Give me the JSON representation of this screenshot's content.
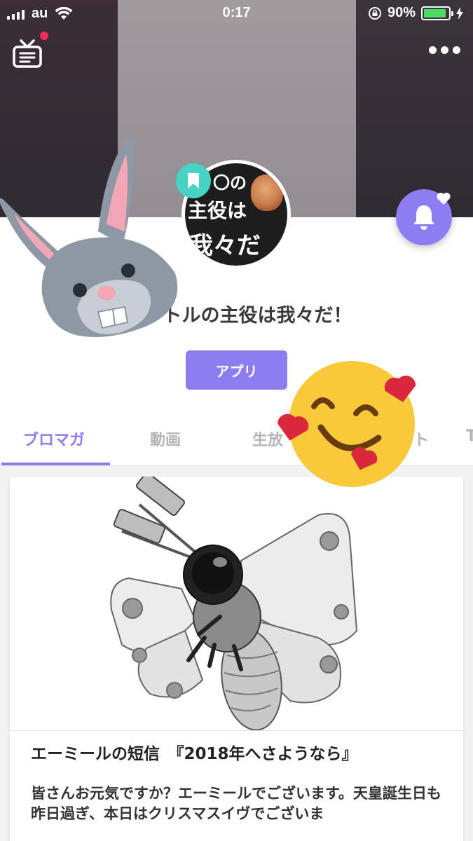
{
  "status_bar": {
    "carrier": "au",
    "time": "0:17",
    "battery": "90%",
    "battery_level": 0.9
  },
  "channel": {
    "title": "トルの主役は我々だ！",
    "app_button": "アプリ",
    "avatar_text": [
      "〇の",
      "主役は",
      "我々だ"
    ]
  },
  "tabs": [
    {
      "label": "ブロマガ",
      "active": true
    },
    {
      "label": "動画",
      "active": false
    },
    {
      "label": "生放",
      "active": false
    },
    {
      "label": "ト",
      "active": false
    },
    {
      "label": "T",
      "active": false
    }
  ],
  "article": {
    "title": "エーミールの短信　『2018年へさようなら』",
    "body": "皆さんお元気ですか？エーミールでございます。天皇誕生日も昨日過ぎ、本日はクリスマスイヴでございま"
  },
  "colors": {
    "accent": "#8e7cf2",
    "badge": "#46d3c5",
    "notification_dot": "#ff2a55"
  },
  "icons": [
    "tv-icon",
    "more-icon",
    "bookmark-icon",
    "bell-icon",
    "heart-icon"
  ]
}
